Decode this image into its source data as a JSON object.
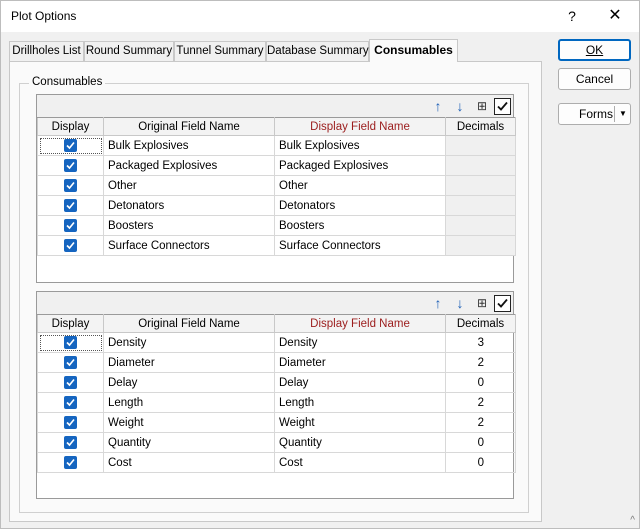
{
  "window": {
    "title": "Plot Options",
    "help_label": "?",
    "close_label": "✕"
  },
  "tabs": [
    {
      "label": "Drillholes List",
      "active": false
    },
    {
      "label": "Round Summary",
      "active": false
    },
    {
      "label": "Tunnel Summary",
      "active": false
    },
    {
      "label": "Database Summary",
      "active": false
    },
    {
      "label": "Consumables",
      "active": true
    }
  ],
  "group_label": "Consumables",
  "columns": {
    "display": "Display",
    "original": "Original Field Name",
    "display_name": "Display Field Name",
    "decimals": "Decimals"
  },
  "grid1": {
    "rows": [
      {
        "checked": true,
        "original": "Bulk Explosives",
        "display_name": "Bulk Explosives",
        "decimals": ""
      },
      {
        "checked": true,
        "original": "Packaged Explosives",
        "display_name": "Packaged Explosives",
        "decimals": ""
      },
      {
        "checked": true,
        "original": "Other",
        "display_name": "Other",
        "decimals": ""
      },
      {
        "checked": true,
        "original": "Detonators",
        "display_name": "Detonators",
        "decimals": ""
      },
      {
        "checked": true,
        "original": "Boosters",
        "display_name": "Boosters",
        "decimals": ""
      },
      {
        "checked": true,
        "original": "Surface Connectors",
        "display_name": "Surface Connectors",
        "decimals": ""
      }
    ]
  },
  "grid2": {
    "rows": [
      {
        "checked": true,
        "original": "Density",
        "display_name": "Density",
        "decimals": "3"
      },
      {
        "checked": true,
        "original": "Diameter",
        "display_name": "Diameter",
        "decimals": "2"
      },
      {
        "checked": true,
        "original": "Delay",
        "display_name": "Delay",
        "decimals": "0"
      },
      {
        "checked": true,
        "original": "Length",
        "display_name": "Length",
        "decimals": "2"
      },
      {
        "checked": true,
        "original": "Weight",
        "display_name": "Weight",
        "decimals": "2"
      },
      {
        "checked": true,
        "original": "Quantity",
        "display_name": "Quantity",
        "decimals": "0"
      },
      {
        "checked": true,
        "original": "Cost",
        "display_name": "Cost",
        "decimals": "0"
      }
    ]
  },
  "toolbar": {
    "up_icon": "↑",
    "down_icon": "↓",
    "columns_icon": "⊞"
  },
  "buttons": {
    "ok": "OK",
    "cancel": "Cancel",
    "forms": "Forms",
    "forms_caret": "▼"
  },
  "colors": {
    "accent": "#0067c0",
    "checkbox": "#1565c0",
    "display_header": "#9b1c1c"
  }
}
